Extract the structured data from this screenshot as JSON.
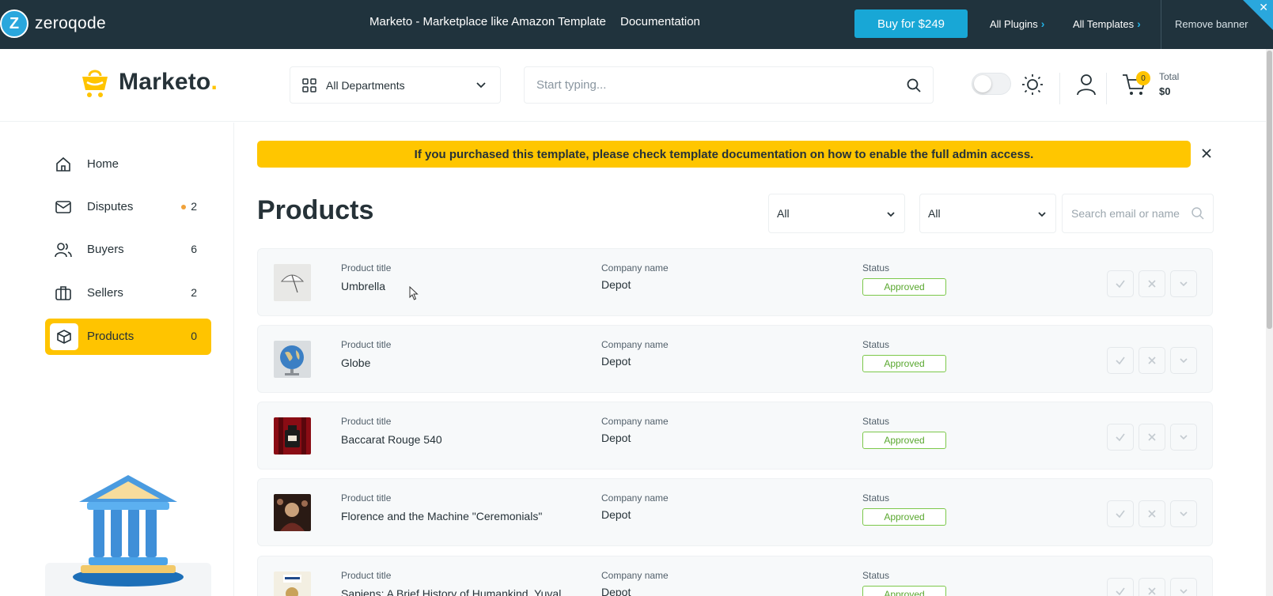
{
  "promo": {
    "logo_text": "zeroqode",
    "title": "Marketo - Marketplace like Amazon Template",
    "documentation": "Documentation",
    "buy_label": "Buy for $249",
    "all_plugins": "All Plugins",
    "all_templates": "All Templates",
    "remove_banner": "Remove banner",
    "accent": "#18a7d6"
  },
  "header": {
    "brand_name": "Marketo",
    "brand_dot": ".",
    "departments_label": "All Departments",
    "search_placeholder": "Start typing...",
    "cart_count": "0",
    "total_label": "Total",
    "total_value": "$0"
  },
  "sidebar": {
    "items": [
      {
        "label": "Home",
        "icon": "home-icon",
        "count": ""
      },
      {
        "label": "Disputes",
        "icon": "mail-icon",
        "count": "2"
      },
      {
        "label": "Buyers",
        "icon": "users-icon",
        "count": "6"
      },
      {
        "label": "Sellers",
        "icon": "briefcase-icon",
        "count": "2"
      },
      {
        "label": "Products",
        "icon": "box-icon",
        "count": "0"
      }
    ]
  },
  "main": {
    "notice": "If you purchased this template, please check template documentation on how to enable the full admin access.",
    "title": "Products",
    "filter1": "All",
    "filter2": "All",
    "search_placeholder": "Search email or name",
    "col_product": "Product title",
    "col_company": "Company name",
    "col_status": "Status",
    "rows": [
      {
        "title": "Umbrella",
        "company": "Depot",
        "status": "Approved"
      },
      {
        "title": "Globe",
        "company": "Depot",
        "status": "Approved"
      },
      {
        "title": "Baccarat Rouge 540",
        "company": "Depot",
        "status": "Approved"
      },
      {
        "title": "Florence and the Machine \"Ceremonials\"",
        "company": "Depot",
        "status": "Approved"
      },
      {
        "title": "Sapiens: A Brief History of Humankind, Yuval",
        "company": "Depot",
        "status": "Approved"
      }
    ]
  },
  "colors": {
    "brand_yellow": "#ffc400",
    "status_green": "#5aa830",
    "dark_banner": "#20333d"
  }
}
